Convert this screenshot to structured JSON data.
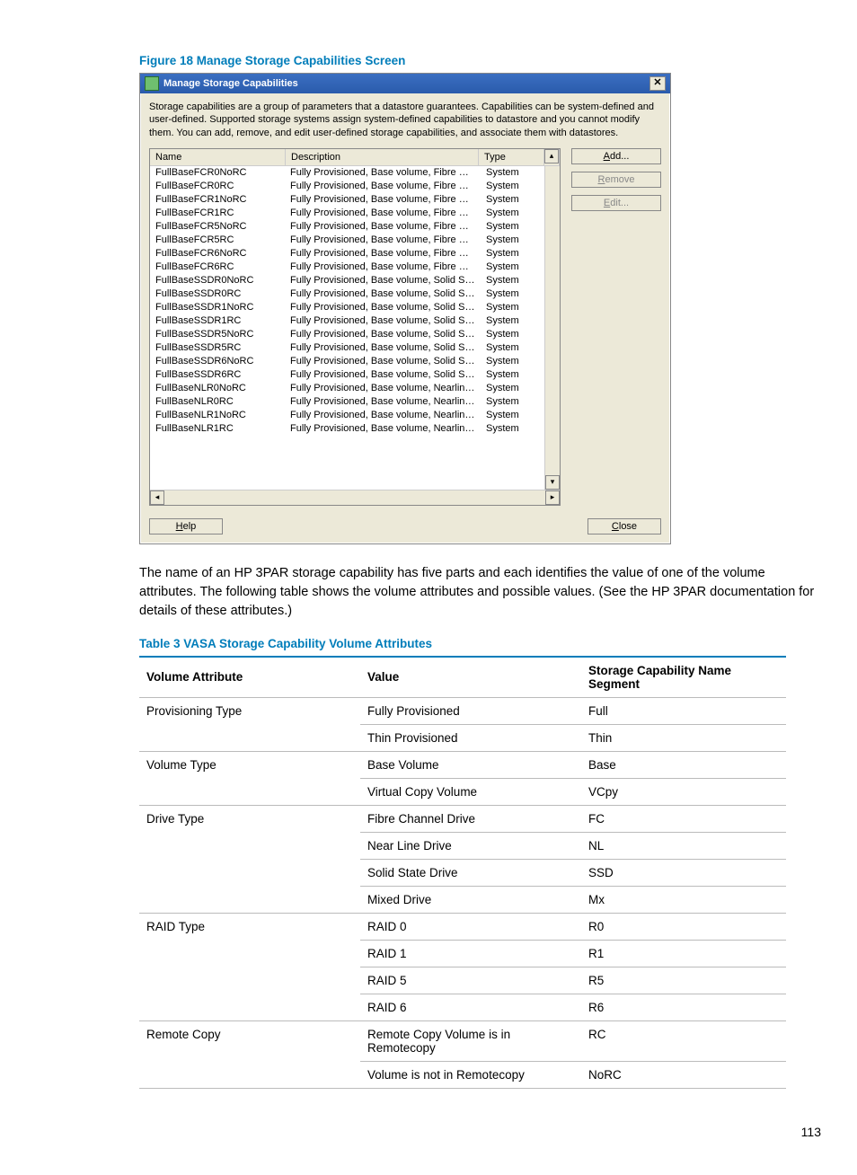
{
  "figure_title": "Figure 18 Manage Storage Capabilities Screen",
  "dialog": {
    "title": "Manage Storage Capabilities",
    "intro": "Storage capabilities are a group of parameters that a datastore guarantees. Capabilities can be system-defined and user-defined. Supported storage systems assign system-defined capabilities to datastore and you cannot modify them. You can add, remove, and edit user-defined storage capabilities, and associate them with datastores.",
    "headers": {
      "name": "Name",
      "description": "Description",
      "type": "Type"
    },
    "rows": [
      {
        "name": "FullBaseFCR0NoRC",
        "desc": "Fully Provisioned, Base volume, Fibre Chann...",
        "type": "System"
      },
      {
        "name": "FullBaseFCR0RC",
        "desc": "Fully Provisioned, Base volume, Fibre Chann...",
        "type": "System"
      },
      {
        "name": "FullBaseFCR1NoRC",
        "desc": "Fully Provisioned, Base volume, Fibre Chann...",
        "type": "System"
      },
      {
        "name": "FullBaseFCR1RC",
        "desc": "Fully Provisioned, Base volume, Fibre Chann...",
        "type": "System"
      },
      {
        "name": "FullBaseFCR5NoRC",
        "desc": "Fully Provisioned, Base volume, Fibre Chann...",
        "type": "System"
      },
      {
        "name": "FullBaseFCR5RC",
        "desc": "Fully Provisioned, Base volume, Fibre Chann...",
        "type": "System"
      },
      {
        "name": "FullBaseFCR6NoRC",
        "desc": "Fully Provisioned, Base volume, Fibre Chann...",
        "type": "System"
      },
      {
        "name": "FullBaseFCR6RC",
        "desc": "Fully Provisioned, Base volume, Fibre Chann...",
        "type": "System"
      },
      {
        "name": "FullBaseSSDR0NoRC",
        "desc": "Fully Provisioned, Base volume, Solid State ...",
        "type": "System"
      },
      {
        "name": "FullBaseSSDR0RC",
        "desc": "Fully Provisioned, Base volume, Solid State ...",
        "type": "System"
      },
      {
        "name": "FullBaseSSDR1NoRC",
        "desc": "Fully Provisioned, Base volume, Solid State ...",
        "type": "System"
      },
      {
        "name": "FullBaseSSDR1RC",
        "desc": "Fully Provisioned, Base volume, Solid State ...",
        "type": "System"
      },
      {
        "name": "FullBaseSSDR5NoRC",
        "desc": "Fully Provisioned, Base volume, Solid State ...",
        "type": "System"
      },
      {
        "name": "FullBaseSSDR5RC",
        "desc": "Fully Provisioned, Base volume, Solid State ...",
        "type": "System"
      },
      {
        "name": "FullBaseSSDR6NoRC",
        "desc": "Fully Provisioned, Base volume, Solid State ...",
        "type": "System"
      },
      {
        "name": "FullBaseSSDR6RC",
        "desc": "Fully Provisioned, Base volume, Solid State ...",
        "type": "System"
      },
      {
        "name": "FullBaseNLR0NoRC",
        "desc": "Fully Provisioned, Base volume, Nearline Dri...",
        "type": "System"
      },
      {
        "name": "FullBaseNLR0RC",
        "desc": "Fully Provisioned, Base volume, Nearline Dri...",
        "type": "System"
      },
      {
        "name": "FullBaseNLR1NoRC",
        "desc": "Fully Provisioned, Base volume, Nearline Dri...",
        "type": "System"
      },
      {
        "name": "FullBaseNLR1RC",
        "desc": "Fully Provisioned, Base volume, Nearline Dri...",
        "type": "System"
      }
    ],
    "buttons": {
      "add": "Add...",
      "remove": "Remove",
      "edit": "Edit...",
      "help": "Help",
      "close": "Close"
    }
  },
  "body_text": "The name of an HP 3PAR storage capability has five parts and each identifies the value of one of the volume attributes. The following table shows the volume attributes and possible values. (See the HP 3PAR documentation for details of these attributes.)",
  "table_title": "Table 3 VASA Storage Capability Volume Attributes",
  "table": {
    "headers": {
      "attr": "Volume Attribute",
      "value": "Value",
      "segment": "Storage Capability Name Segment"
    },
    "groups": [
      {
        "attr": "Provisioning Type",
        "rows": [
          {
            "value": "Fully Provisioned",
            "segment": "Full"
          },
          {
            "value": "Thin Provisioned",
            "segment": "Thin"
          }
        ]
      },
      {
        "attr": "Volume Type",
        "rows": [
          {
            "value": "Base Volume",
            "segment": "Base"
          },
          {
            "value": "Virtual Copy Volume",
            "segment": "VCpy"
          }
        ]
      },
      {
        "attr": "Drive Type",
        "rows": [
          {
            "value": "Fibre Channel Drive",
            "segment": "FC"
          },
          {
            "value": "Near Line Drive",
            "segment": "NL"
          },
          {
            "value": "Solid State Drive",
            "segment": "SSD"
          },
          {
            "value": "Mixed Drive",
            "segment": "Mx"
          }
        ]
      },
      {
        "attr": "RAID Type",
        "rows": [
          {
            "value": "RAID 0",
            "segment": "R0"
          },
          {
            "value": "RAID 1",
            "segment": "R1"
          },
          {
            "value": "RAID 5",
            "segment": "R5"
          },
          {
            "value": "RAID 6",
            "segment": "R6"
          }
        ]
      },
      {
        "attr": "Remote Copy",
        "rows": [
          {
            "value": "Remote Copy Volume is in Remotecopy",
            "segment": "RC"
          },
          {
            "value": "Volume is not in Remotecopy",
            "segment": "NoRC"
          }
        ]
      }
    ]
  },
  "page_number": "113"
}
